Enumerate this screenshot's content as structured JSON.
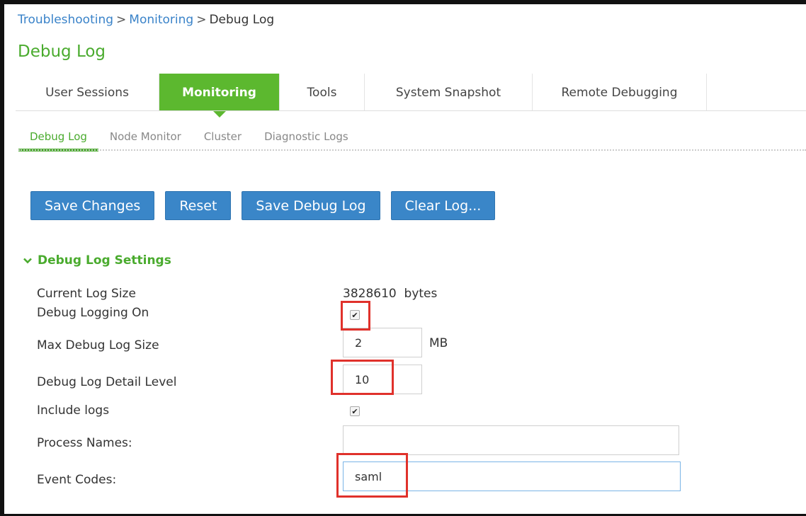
{
  "breadcrumb": {
    "item1": "Troubleshooting",
    "sep1": ">",
    "item2": "Monitoring",
    "sep2": ">",
    "current": "Debug Log"
  },
  "page_title": "Debug Log",
  "tabs": [
    {
      "label": "User Sessions"
    },
    {
      "label": "Monitoring"
    },
    {
      "label": "Tools"
    },
    {
      "label": "System Snapshot"
    },
    {
      "label": "Remote Debugging"
    }
  ],
  "active_tab": "Monitoring",
  "subtabs": [
    {
      "label": "Debug Log"
    },
    {
      "label": "Node Monitor"
    },
    {
      "label": "Cluster"
    },
    {
      "label": "Diagnostic Logs"
    }
  ],
  "active_subtab": "Debug Log",
  "buttons": {
    "save_changes": "Save Changes",
    "reset": "Reset",
    "save_debug_log": "Save Debug Log",
    "clear_log": "Clear Log..."
  },
  "section": {
    "title": "Debug Log Settings"
  },
  "settings": {
    "current_log_size_label": "Current Log Size",
    "current_log_size_value": "3828610",
    "current_log_size_unit": "bytes",
    "debug_logging_on_label": "Debug Logging On",
    "debug_logging_on_checked": true,
    "max_debug_log_size_label": "Max Debug Log Size",
    "max_debug_log_size_value": "2",
    "max_debug_log_size_unit": "MB",
    "detail_level_label": "Debug Log Detail Level",
    "detail_level_value": "10",
    "include_logs_label": "Include logs",
    "include_logs_checked": true,
    "process_names_label": "Process Names:",
    "process_names_value": "",
    "event_codes_label": "Event Codes:",
    "event_codes_value": "saml"
  },
  "colors": {
    "accent_green": "#5cb82f",
    "title_green": "#4aab2e",
    "button_blue": "#3a86c8",
    "link_blue": "#3a83c9",
    "highlight_red": "#e0312b"
  },
  "icons": {
    "section_toggle": "chevron-down-icon",
    "checkbox_mark": "check-icon"
  }
}
